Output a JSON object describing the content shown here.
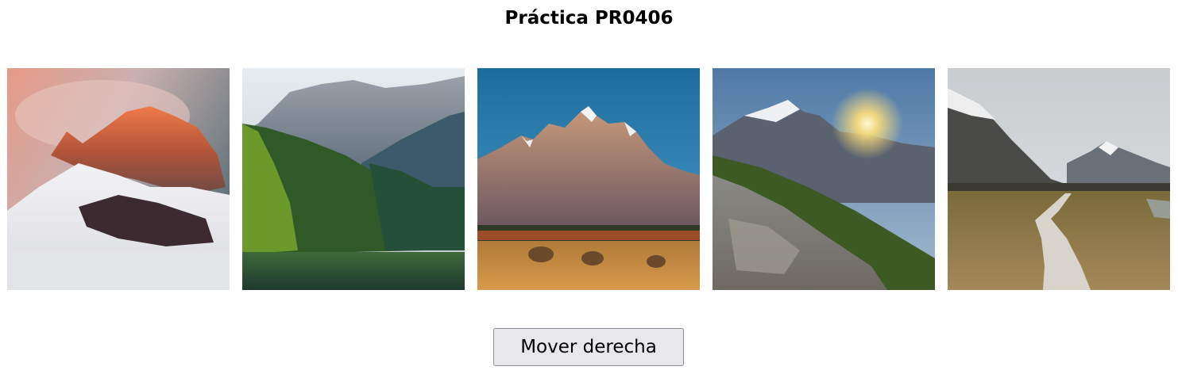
{
  "page": {
    "title": "Práctica PR0406"
  },
  "gallery": {
    "images": [
      {
        "subject": "snowy mountain peaks at sunset glow"
      },
      {
        "subject": "rocky mountains above pine forest and lake"
      },
      {
        "subject": "jagged mountain range over autumn plain"
      },
      {
        "subject": "mountain slope with sunburst"
      },
      {
        "subject": "boardwalk path through grassland to snowy peaks"
      }
    ]
  },
  "controls": {
    "move_right_label": "Mover derecha"
  }
}
